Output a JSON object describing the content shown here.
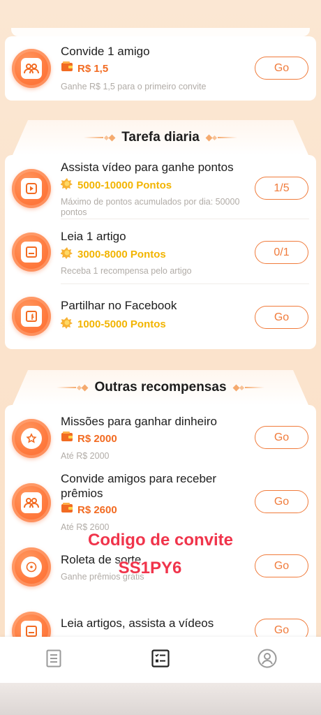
{
  "invite_card": {
    "title": "Convide 1 amigo",
    "reward": "R$ 1,5",
    "desc": "Ganhe R$ 1,5 para o primeiro convite",
    "button": "Go",
    "icon": "people-icon"
  },
  "daily_section": {
    "title": "Tarefa diaria",
    "tasks": [
      {
        "title": "Assista vídeo para ganhe pontos",
        "reward": "5000-10000 Pontos",
        "desc": "Máximo de pontos acumulados por dia: 50000 pontos",
        "button": "1/5",
        "icon": "play-icon"
      },
      {
        "title": "Leia 1 artigo",
        "reward": "3000-8000 Pontos",
        "desc": "Receba 1 recompensa pelo artigo",
        "button": "0/1",
        "icon": "article-icon"
      },
      {
        "title": "Partilhar no Facebook",
        "reward": "1000-5000 Pontos",
        "desc": "",
        "button": "Go",
        "icon": "facebook-icon"
      }
    ]
  },
  "other_section": {
    "title": "Outras recompensas",
    "tasks": [
      {
        "title": "Missões para ganhar dinheiro",
        "reward": "R$ 2000",
        "desc": "Até R$ 2000",
        "button": "Go",
        "icon": "star-badge-icon"
      },
      {
        "title": "Convide amigos para receber prêmios",
        "reward": "R$ 2600",
        "desc": "Até R$ 2600",
        "button": "Go",
        "icon": "people-icon"
      },
      {
        "title": "Roleta de sorte",
        "reward": "",
        "desc": "Ganhe prêmios grátis",
        "button": "Go",
        "icon": "wheel-icon"
      },
      {
        "title": "Leia artigos, assista a vídeos",
        "reward": "",
        "desc": "",
        "button": "Go",
        "icon": "article-icon"
      }
    ]
  },
  "overlay": {
    "line1": "Codigo de convite",
    "line2": "SS1PY6"
  },
  "bottom_nav": [
    {
      "name": "news",
      "icon": "document-icon"
    },
    {
      "name": "tasks",
      "icon": "tasks-icon",
      "active": true
    },
    {
      "name": "profile",
      "icon": "user-icon"
    }
  ],
  "colors": {
    "accent": "#f26b22",
    "points": "#f2b400",
    "overlay_red": "#f0344b"
  }
}
